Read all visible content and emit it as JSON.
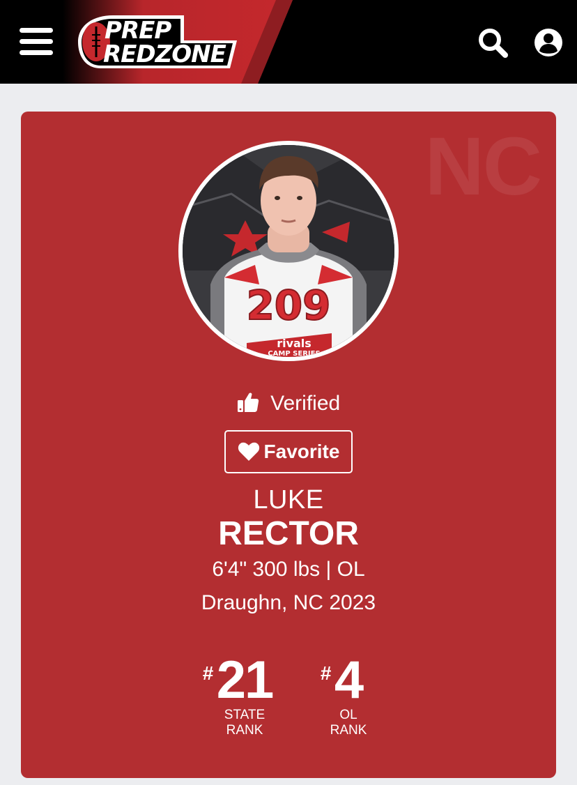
{
  "header": {
    "logo_line1": "PREP",
    "logo_line2": "REDZONE"
  },
  "profile": {
    "state_watermark": "NC",
    "jersey_number": "209",
    "jersey_brand": "rivals",
    "jersey_series": "CAMP SERIES",
    "verified_label": "Verified",
    "favorite_label": "Favorite",
    "first_name": "LUKE",
    "last_name": "RECTOR",
    "measurements": "6'4\" 300 lbs | OL",
    "location": "Draughn, NC 2023"
  },
  "ranks": [
    {
      "hash": "#",
      "value": "21",
      "label_line1": "STATE",
      "label_line2": "RANK"
    },
    {
      "hash": "#",
      "value": "4",
      "label_line1": "OL",
      "label_line2": "RANK"
    }
  ],
  "colors": {
    "header_bg": "#000000",
    "brand_red": "#c5282d",
    "card_bg": "#b32e31",
    "page_bg": "#ecedf0"
  }
}
